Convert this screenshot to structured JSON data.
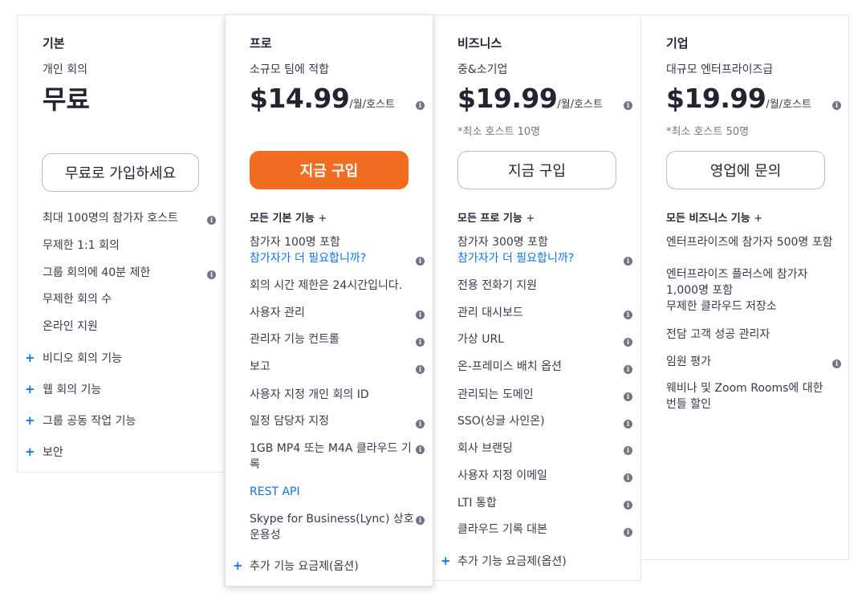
{
  "plans": {
    "basic": {
      "name": "기본",
      "subtitle": "개인 회의",
      "price": "무료",
      "button": "무료로 가입하세요",
      "features": [
        "최대 100명의 참가자 호스트",
        "무제한 1:1 회의",
        "그룹 회의에 40분 제한",
        "무제한 회의 수",
        "온라인 지원"
      ],
      "expandables": [
        "비디오 회의 기능",
        "웹 회의 기능",
        "그룹 공동 작업 기능",
        "보안"
      ]
    },
    "pro": {
      "name": "프로",
      "subtitle": "소규모 팀에 적합",
      "price": "$14.99",
      "per": "/월/호스트",
      "button": "지금 구입",
      "includes": "모든 기본 기능",
      "features": [
        "참가자 100명 포함",
        "참가자가 더 필요합니까?",
        "회의 시간 제한은 24시간입니다.",
        "사용자 관리",
        "관리자 기능 컨트롤",
        "보고",
        "사용자 지정 개인 회의 ID",
        "일정 담당자 지정",
        "1GB MP4 또는 M4A 클라우드 기록",
        "REST API",
        "Skype for Business(Lync) 상호 운용성"
      ],
      "addon": "추가 기능 요금제(옵션)"
    },
    "business": {
      "name": "비즈니스",
      "subtitle": "중&소기업",
      "price": "$19.99",
      "per": "/월/호스트",
      "min_hosts": "*최소 호스트 10명",
      "button": "지금 구입",
      "includes": "모든 프로 기능",
      "features": [
        "참가자 300명 포함",
        "참가자가 더 필요합니까?",
        "전용 전화기 지원",
        "관리 대시보드",
        "가상 URL",
        "온-프레미스 배치 옵션",
        "관리되는 도메인",
        "SSO(싱글 사인온)",
        "회사 브랜딩",
        "사용자 지정 이메일",
        "LTI 통합",
        "클라우드 기록 대본"
      ],
      "addon": "추가 기능 요금제(옵션)"
    },
    "enterprise": {
      "name": "기업",
      "subtitle": "대규모 엔터프라이즈급",
      "price": "$19.99",
      "per": "/월/호스트",
      "min_hosts": "*최소 호스트 50명",
      "button": "영업에 문의",
      "includes": "모든 비즈니스 기능",
      "features": [
        "엔터프라이즈에 참가자 500명 포함",
        "엔터프라이즈 플러스에 참가자 1,000명 포함",
        "무제한 클라우드 저장소",
        "전담 고객 성공 관리자",
        "임원 평가",
        "웨비나 및 Zoom Rooms에 대한 번들 할인"
      ]
    }
  },
  "symbols": {
    "plus": "+",
    "info": "i"
  },
  "colors": {
    "accent": "#f26d21",
    "link": "#0e71eb",
    "info_icon": "#747487"
  }
}
